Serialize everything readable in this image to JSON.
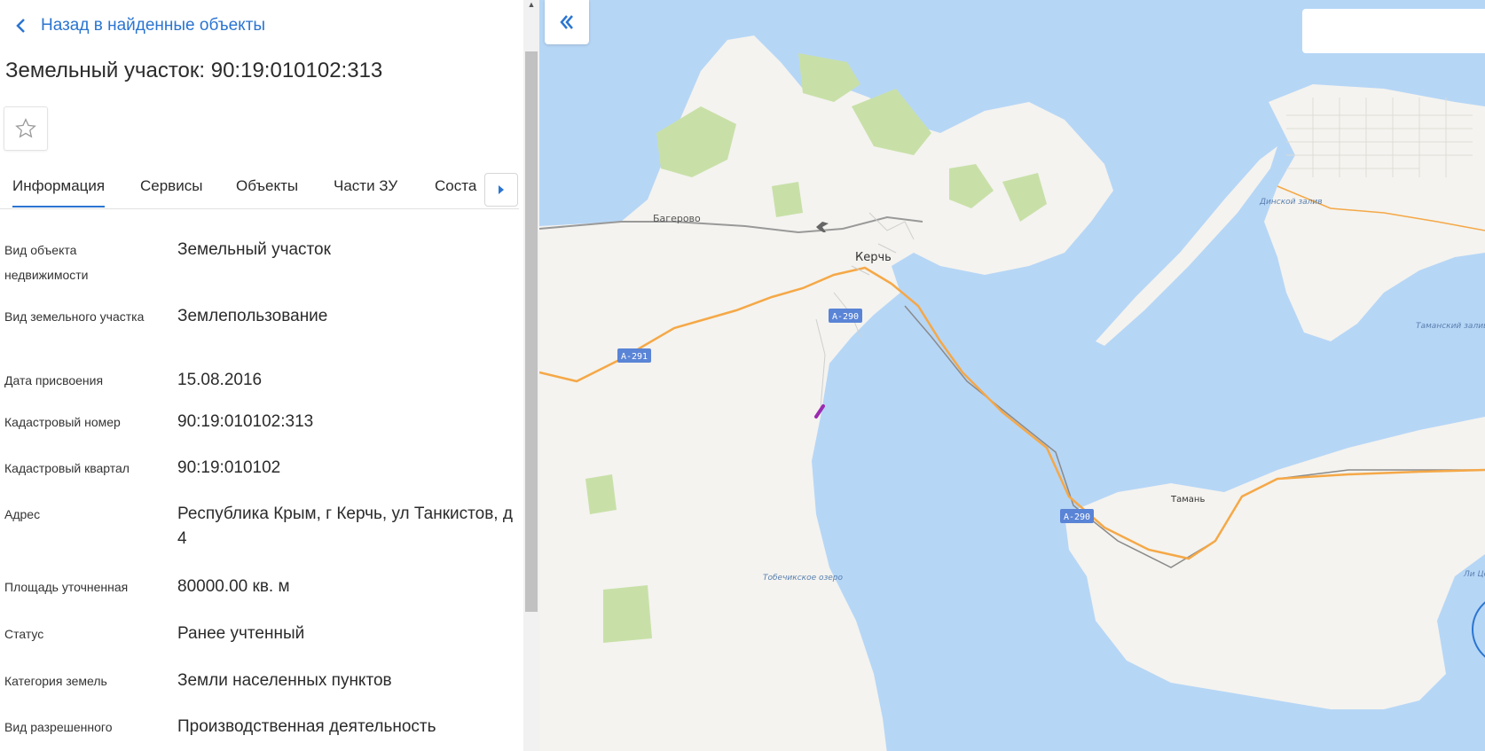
{
  "panel": {
    "back_label": "Назад в найденные объекты",
    "title": "Земельный участок: 90:19:010102:313",
    "tabs": [
      "Информация",
      "Сервисы",
      "Объекты",
      "Части ЗУ",
      "Соста"
    ],
    "active_tab": "Информация",
    "rows": [
      {
        "label": "Вид объекта недвижимости",
        "value": "Земельный участок"
      },
      {
        "label": "Вид земельного участка",
        "value": "Землепользование"
      },
      {
        "label": "Дата присвоения",
        "value": "15.08.2016"
      },
      {
        "label": "Кадастровый номер",
        "value": "90:19:010102:313"
      },
      {
        "label": "Кадастровый квартал",
        "value": "90:19:010102"
      },
      {
        "label": "Адрес",
        "value": "Республика Крым, г Керчь, ул Танкистов, д 4"
      },
      {
        "label": "Площадь уточненная",
        "value": "80000.00 кв. м"
      },
      {
        "label": "Статус",
        "value": "Ранее учтенный"
      },
      {
        "label": "Категория земель",
        "value": "Земли населенных пунктов"
      },
      {
        "label": "Вид разрешенного",
        "value": "Производственная деятельность"
      }
    ]
  },
  "map": {
    "labels": {
      "bagerovo": "Багерово",
      "kerch": "Керчь",
      "taman": "Тамань",
      "dinskoy": "Динской залив",
      "tamansky": "Таманский залив",
      "tobechik": "Тобечикское озеро",
      "road_a290_1": "А-290",
      "road_a290_2": "А-290",
      "road_a291": "А-291",
      "edge_text": "Ли Цо"
    },
    "colors": {
      "water": "#b6d6f6",
      "land": "#f4f3ef",
      "green": "#c8e0a8",
      "road_main": "#f5a847",
      "road_badge": "#5a84d6",
      "parcel": "#9b2bb0",
      "accent": "#2b75d1"
    }
  },
  "search": {
    "placeholder": ""
  }
}
